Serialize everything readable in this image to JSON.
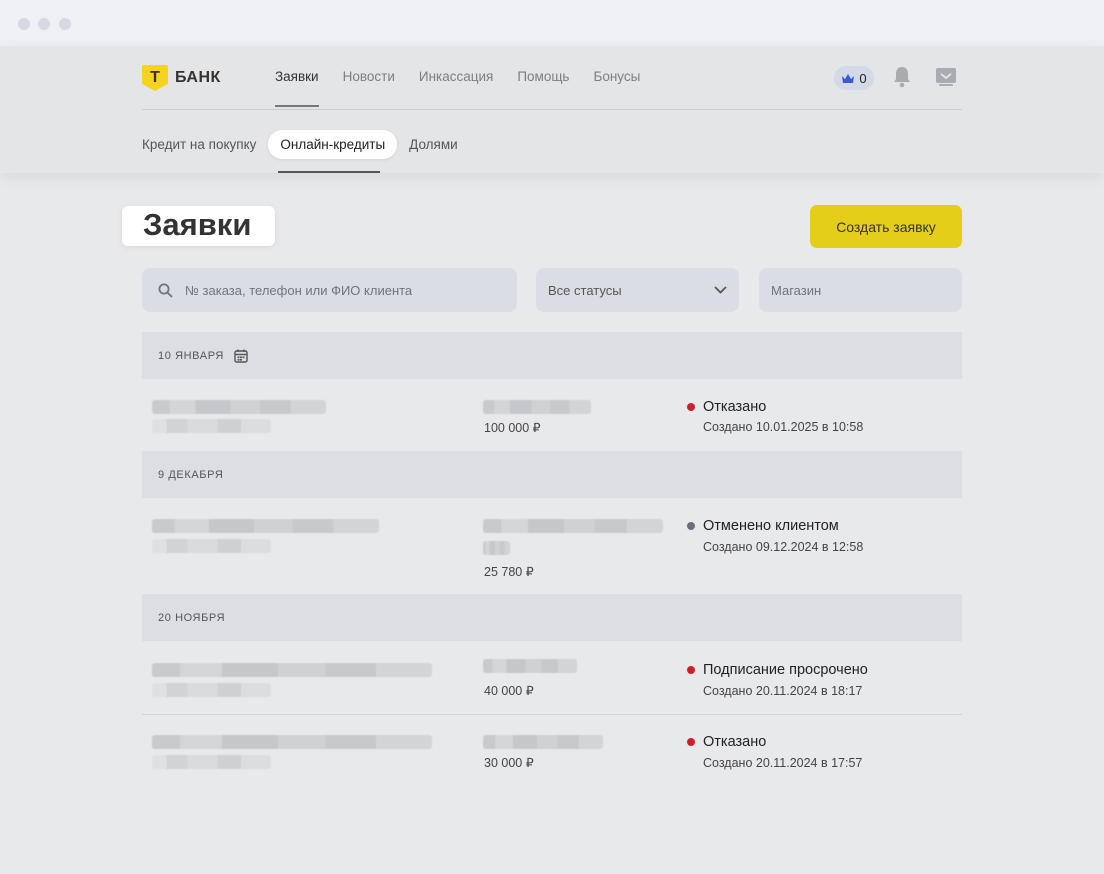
{
  "brand": {
    "logo_letter": "Т",
    "name": "БАНК",
    "accent": "#f6d31f"
  },
  "nav": [
    "Заявки",
    "Новости",
    "Инкассация",
    "Помощь",
    "Бонусы"
  ],
  "crown_count": "0",
  "subnav": [
    "Кредит на покупку",
    "Онлайн-кредиты",
    "Долями"
  ],
  "page": {
    "title": "Заявки",
    "create_button": "Создать заявку"
  },
  "filters": {
    "search_placeholder": "№ заказа, телефон или ФИО клиента",
    "status": "Все статусы",
    "store_placeholder": "Магазин"
  },
  "groups": [
    {
      "date": "10 ЯНВАРЯ",
      "items": [
        {
          "amount": "100 000 ₽",
          "status": "Отказано",
          "status_color": "#c8232c",
          "created": "Создано 10.01.2025 в 10:58"
        }
      ]
    },
    {
      "date": "9 ДЕКАБРЯ",
      "items": [
        {
          "amount": "25 780 ₽",
          "status": "Отменено клиентом",
          "status_color": "#6b6f7b",
          "created": "Создано 09.12.2024 в 12:58"
        }
      ]
    },
    {
      "date": "20 НОЯБРЯ",
      "items": [
        {
          "amount": "40 000 ₽",
          "status": "Подписание просрочено",
          "status_color": "#c8232c",
          "created": "Создано 20.11.2024 в 18:17"
        },
        {
          "amount": "30 000 ₽",
          "status": "Отказано",
          "status_color": "#c8232c",
          "created": "Создано 20.11.2024 в 17:57"
        }
      ]
    }
  ]
}
